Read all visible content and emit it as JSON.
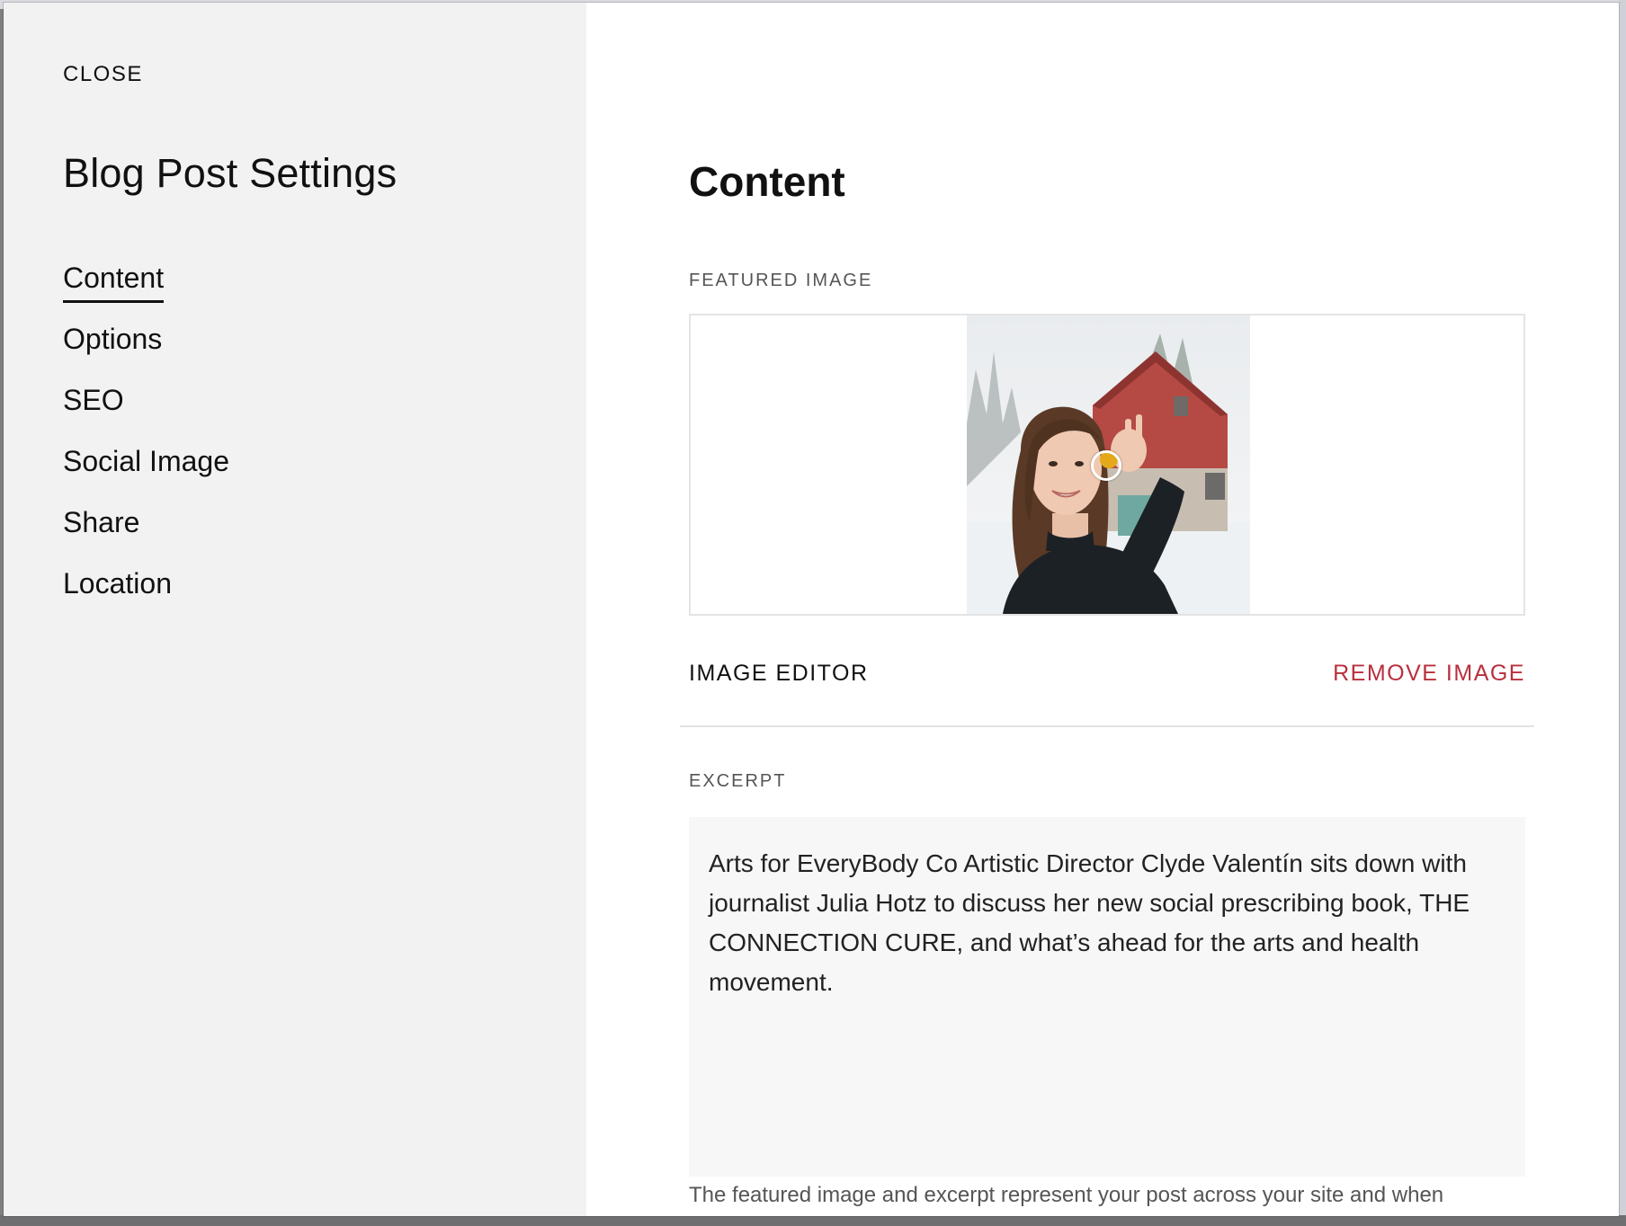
{
  "sidebar": {
    "close_label": "CLOSE",
    "title": "Blog Post Settings",
    "items": [
      {
        "label": "Content",
        "active": true
      },
      {
        "label": "Options",
        "active": false
      },
      {
        "label": "SEO",
        "active": false
      },
      {
        "label": "Social Image",
        "active": false
      },
      {
        "label": "Share",
        "active": false
      },
      {
        "label": "Location",
        "active": false
      }
    ]
  },
  "main": {
    "title": "Content",
    "featured_image": {
      "label": "FEATURED IMAGE",
      "image_editor_label": "IMAGE EDITOR",
      "remove_image_label": "REMOVE IMAGE"
    },
    "excerpt": {
      "label": "EXCERPT",
      "value": "Arts for EveryBody Co Artistic Director Clyde Valentín sits down with journalist Julia Hotz to discuss her new social prescribing book, THE CONNECTION CURE, and what’s ahead for the arts and health movement."
    },
    "help_text": "The featured image and excerpt represent your post across your site and when"
  },
  "colors": {
    "sidebar_bg": "#f2f2f2",
    "main_bg": "#ffffff",
    "remove_accent": "#b8303c",
    "excerpt_bg": "#f7f7f7"
  }
}
